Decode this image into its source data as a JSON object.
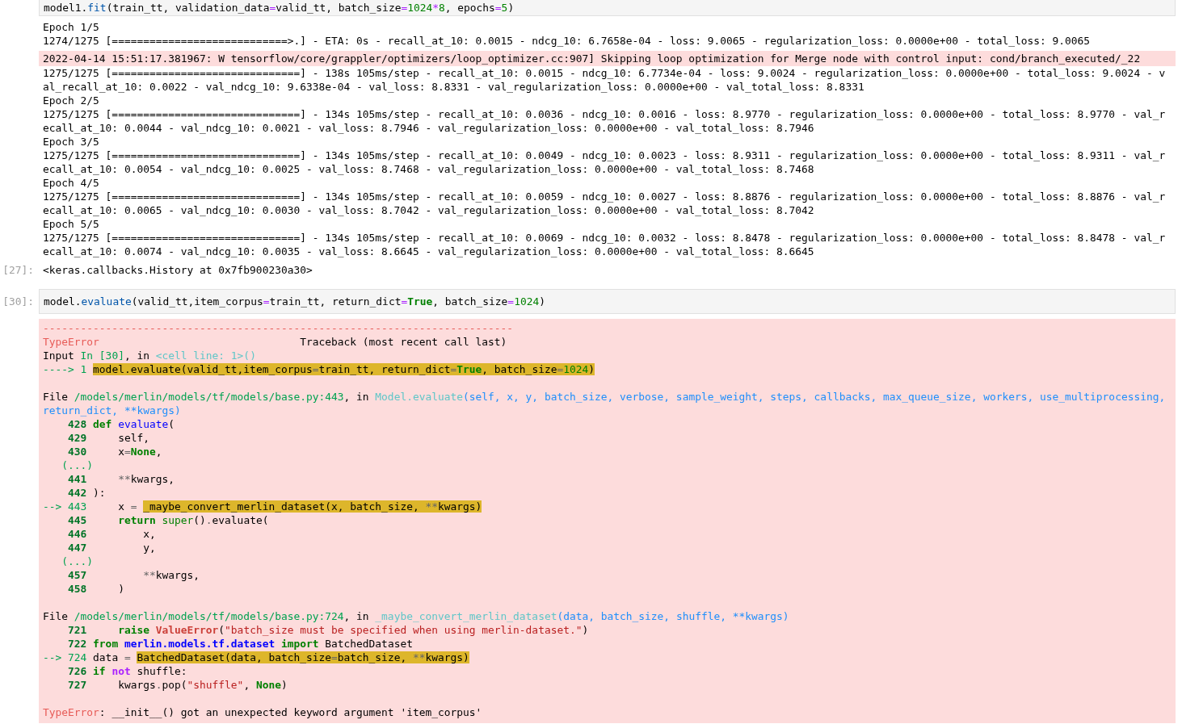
{
  "cells": [
    {
      "input": {
        "tokens": [
          {
            "kind": "plain",
            "text": "model1."
          },
          {
            "kind": "attr",
            "text": "fit"
          },
          {
            "kind": "plain",
            "text": "(train_tt, validation_data"
          },
          {
            "kind": "op",
            "text": "="
          },
          {
            "kind": "plain",
            "text": "valid_tt, batch_size"
          },
          {
            "kind": "op",
            "text": "="
          },
          {
            "kind": "num",
            "text": "1024"
          },
          {
            "kind": "op",
            "text": "*"
          },
          {
            "kind": "num",
            "text": "8"
          },
          {
            "kind": "plain",
            "text": ", epochs"
          },
          {
            "kind": "op",
            "text": "="
          },
          {
            "kind": "num",
            "text": "5"
          },
          {
            "kind": "plain",
            "text": ")"
          }
        ]
      },
      "outputs": [
        {
          "kind": "stdout",
          "lines": [
            "Epoch 1/5",
            "1274/1275 [============================>.] - ETA: 0s - recall_at_10: 0.0015 - ndcg_10: 6.7658e-04 - loss: 9.0065 - regularization_loss: 0.0000e+00 - total_loss: 9.0065"
          ]
        },
        {
          "kind": "stderr",
          "lines": [
            "2022-04-14 15:51:17.381967: W tensorflow/core/grappler/optimizers/loop_optimizer.cc:907] Skipping loop optimization for Merge node with control input: cond/branch_executed/_22"
          ]
        },
        {
          "kind": "stdout",
          "lines": [
            "1275/1275 [==============================] - 138s 105ms/step - recall_at_10: 0.0015 - ndcg_10: 6.7734e-04 - loss: 9.0024 - regularization_loss: 0.0000e+00 - total_loss: 9.0024 - v",
            "al_recall_at_10: 0.0022 - val_ndcg_10: 9.6338e-04 - val_loss: 8.8331 - val_regularization_loss: 0.0000e+00 - val_total_loss: 8.8331",
            "Epoch 2/5",
            "1275/1275 [==============================] - 134s 105ms/step - recall_at_10: 0.0036 - ndcg_10: 0.0016 - loss: 8.9770 - regularization_loss: 0.0000e+00 - total_loss: 8.9770 - val_r",
            "ecall_at_10: 0.0044 - val_ndcg_10: 0.0021 - val_loss: 8.7946 - val_regularization_loss: 0.0000e+00 - val_total_loss: 8.7946",
            "Epoch 3/5",
            "1275/1275 [==============================] - 134s 105ms/step - recall_at_10: 0.0049 - ndcg_10: 0.0023 - loss: 8.9311 - regularization_loss: 0.0000e+00 - total_loss: 8.9311 - val_r",
            "ecall_at_10: 0.0054 - val_ndcg_10: 0.0025 - val_loss: 8.7468 - val_regularization_loss: 0.0000e+00 - val_total_loss: 8.7468",
            "Epoch 4/5",
            "1275/1275 [==============================] - 134s 105ms/step - recall_at_10: 0.0059 - ndcg_10: 0.0027 - loss: 8.8876 - regularization_loss: 0.0000e+00 - total_loss: 8.8876 - val_r",
            "ecall_at_10: 0.0065 - val_ndcg_10: 0.0030 - val_loss: 8.7042 - val_regularization_loss: 0.0000e+00 - val_total_loss: 8.7042",
            "Epoch 5/5",
            "1275/1275 [==============================] - 134s 105ms/step - recall_at_10: 0.0069 - ndcg_10: 0.0032 - loss: 8.8478 - regularization_loss: 0.0000e+00 - total_loss: 8.8478 - val_r",
            "ecall_at_10: 0.0074 - val_ndcg_10: 0.0035 - val_loss: 8.6645 - val_regularization_loss: 0.0000e+00 - val_total_loss: 8.6645"
          ]
        },
        {
          "kind": "result",
          "prompt": "[27]:",
          "lines": [
            "<keras.callbacks.History at 0x7fb900230a30>"
          ]
        }
      ]
    },
    {
      "input": {
        "prompt": "[30]:",
        "tokens": [
          {
            "kind": "plain",
            "text": "model."
          },
          {
            "kind": "attr",
            "text": "evaluate"
          },
          {
            "kind": "plain",
            "text": "(valid_tt,item_corpus"
          },
          {
            "kind": "op",
            "text": "="
          },
          {
            "kind": "plain",
            "text": "train_tt, return_dict"
          },
          {
            "kind": "op",
            "text": "="
          },
          {
            "kind": "kw",
            "text": "True"
          },
          {
            "kind": "plain",
            "text": ", batch_size"
          },
          {
            "kind": "op",
            "text": "="
          },
          {
            "kind": "num",
            "text": "1024"
          },
          {
            "kind": "plain",
            "text": ")"
          }
        ]
      },
      "outputs": [
        {
          "kind": "error",
          "lines": [
            {
              "kind": "text",
              "segs": [
                {
                  "kind": "red",
                  "text": "---------------------------------------------------------------------------"
                }
              ]
            },
            {
              "kind": "text",
              "segs": [
                {
                  "kind": "red",
                  "text": "TypeError"
                },
                {
                  "kind": "plain",
                  "text": "                                Traceback (most recent call last)"
                }
              ]
            },
            {
              "kind": "text",
              "segs": [
                {
                  "kind": "plain",
                  "text": "Input "
                },
                {
                  "kind": "green",
                  "text": "In [30]"
                },
                {
                  "kind": "plain",
                  "text": ", in "
                },
                {
                  "kind": "cyan",
                  "text": "<cell line: 1>()"
                }
              ]
            },
            {
              "kind": "text",
              "segs": [
                {
                  "kind": "green",
                  "text": "----> 1 "
                },
                {
                  "kind": "highlight",
                  "parts": [
                    {
                      "kind": "plain",
                      "text": "model.evaluate(valid_tt,item_corpus"
                    },
                    {
                      "kind": "punct",
                      "text": "="
                    },
                    {
                      "kind": "plain",
                      "text": "train_tt, return_dict"
                    },
                    {
                      "kind": "punct",
                      "text": "="
                    },
                    {
                      "kind": "kw",
                      "text": "True"
                    },
                    {
                      "kind": "plain",
                      "text": ", batch_size"
                    },
                    {
                      "kind": "punct",
                      "text": "="
                    },
                    {
                      "kind": "num",
                      "text": "1024"
                    },
                    {
                      "kind": "plain",
                      "text": ")"
                    }
                  ]
                }
              ]
            },
            {
              "kind": "blank"
            },
            {
              "kind": "text",
              "segs": [
                {
                  "kind": "plain",
                  "text": "File "
                },
                {
                  "kind": "green",
                  "text": "/models/merlin/models/tf/models/base.py:443"
                },
                {
                  "kind": "plain",
                  "text": ", in "
                },
                {
                  "kind": "cyan",
                  "text": "Model.evaluate"
                },
                {
                  "kind": "blue",
                  "text": "(self, x, y, batch_size, verbose, sample_weight, steps, callbacks, max_queue_size, workers, use_multiprocessing,"
                }
              ]
            },
            {
              "kind": "text",
              "segs": [
                {
                  "kind": "blue",
                  "text": "return_dict, **kwargs)"
                }
              ]
            },
            {
              "kind": "text",
              "segs": [
                {
                  "kind": "ln",
                  "text": "    428 "
                },
                {
                  "kind": "kw",
                  "text": "def "
                },
                {
                  "kind": "fn",
                  "text": "evaluate"
                },
                {
                  "kind": "plain",
                  "text": "("
                }
              ]
            },
            {
              "kind": "text",
              "segs": [
                {
                  "kind": "ln",
                  "text": "    429 "
                },
                {
                  "kind": "plain",
                  "text": "    self,"
                }
              ]
            },
            {
              "kind": "text",
              "segs": [
                {
                  "kind": "ln",
                  "text": "    430 "
                },
                {
                  "kind": "plain",
                  "text": "    x"
                },
                {
                  "kind": "punct",
                  "text": "="
                },
                {
                  "kind": "kw",
                  "text": "None"
                },
                {
                  "kind": "plain",
                  "text": ","
                }
              ]
            },
            {
              "kind": "text",
              "segs": [
                {
                  "kind": "green",
                  "text": "   (...)"
                }
              ]
            },
            {
              "kind": "text",
              "segs": [
                {
                  "kind": "ln",
                  "text": "    441     "
                },
                {
                  "kind": "punct",
                  "text": "**"
                },
                {
                  "kind": "plain",
                  "text": "kwargs,"
                }
              ]
            },
            {
              "kind": "text",
              "segs": [
                {
                  "kind": "ln",
                  "text": "    442 "
                },
                {
                  "kind": "plain",
                  "text": "):"
                }
              ]
            },
            {
              "kind": "text",
              "segs": [
                {
                  "kind": "green",
                  "text": "--> 443 "
                },
                {
                  "kind": "plain",
                  "text": "    x "
                },
                {
                  "kind": "punct",
                  "text": "= "
                },
                {
                  "kind": "highlight",
                  "parts": [
                    {
                      "kind": "plain",
                      "text": "_maybe_convert_merlin_dataset(x, batch_size, "
                    },
                    {
                      "kind": "punct",
                      "text": "**"
                    },
                    {
                      "kind": "plain",
                      "text": "kwargs)"
                    }
                  ]
                }
              ]
            },
            {
              "kind": "text",
              "segs": [
                {
                  "kind": "ln",
                  "text": "    445     "
                },
                {
                  "kind": "kw",
                  "text": "return "
                },
                {
                  "kind": "builtin",
                  "text": "super"
                },
                {
                  "kind": "plain",
                  "text": "()"
                },
                {
                  "kind": "punct",
                  "text": "."
                },
                {
                  "kind": "plain",
                  "text": "evaluate("
                }
              ]
            },
            {
              "kind": "text",
              "segs": [
                {
                  "kind": "ln",
                  "text": "    446 "
                },
                {
                  "kind": "plain",
                  "text": "        x,"
                }
              ]
            },
            {
              "kind": "text",
              "segs": [
                {
                  "kind": "ln",
                  "text": "    447 "
                },
                {
                  "kind": "plain",
                  "text": "        y,"
                }
              ]
            },
            {
              "kind": "text",
              "segs": [
                {
                  "kind": "green",
                  "text": "   (...)"
                }
              ]
            },
            {
              "kind": "text",
              "segs": [
                {
                  "kind": "ln",
                  "text": "    457         "
                },
                {
                  "kind": "punct",
                  "text": "**"
                },
                {
                  "kind": "plain",
                  "text": "kwargs,"
                }
              ]
            },
            {
              "kind": "text",
              "segs": [
                {
                  "kind": "ln",
                  "text": "    458 "
                },
                {
                  "kind": "plain",
                  "text": "    )"
                }
              ]
            },
            {
              "kind": "blank"
            },
            {
              "kind": "text",
              "segs": [
                {
                  "kind": "plain",
                  "text": "File "
                },
                {
                  "kind": "green",
                  "text": "/models/merlin/models/tf/models/base.py:724"
                },
                {
                  "kind": "plain",
                  "text": ", in "
                },
                {
                  "kind": "cyan",
                  "text": "_maybe_convert_merlin_dataset"
                },
                {
                  "kind": "blue",
                  "text": "(data, batch_size, shuffle, **kwargs)"
                }
              ]
            },
            {
              "kind": "text",
              "segs": [
                {
                  "kind": "ln",
                  "text": "    721     "
                },
                {
                  "kind": "kw",
                  "text": "raise "
                },
                {
                  "kind": "exc",
                  "text": "ValueError"
                },
                {
                  "kind": "plain",
                  "text": "("
                },
                {
                  "kind": "str",
                  "text": "\"batch_size must be specified when using merlin-dataset.\""
                },
                {
                  "kind": "plain",
                  "text": ")"
                }
              ]
            },
            {
              "kind": "text",
              "segs": [
                {
                  "kind": "ln",
                  "text": "    722 "
                },
                {
                  "kind": "kw",
                  "text": "from "
                },
                {
                  "kind": "module",
                  "text": "merlin.models.tf.dataset "
                },
                {
                  "kind": "kw",
                  "text": "import"
                },
                {
                  "kind": "plain",
                  "text": " BatchedDataset"
                }
              ]
            },
            {
              "kind": "text",
              "segs": [
                {
                  "kind": "green",
                  "text": "--> 724 "
                },
                {
                  "kind": "plain",
                  "text": "data "
                },
                {
                  "kind": "punct",
                  "text": "= "
                },
                {
                  "kind": "highlight",
                  "parts": [
                    {
                      "kind": "plain",
                      "text": "BatchedDataset(data, batch_size"
                    },
                    {
                      "kind": "punct",
                      "text": "="
                    },
                    {
                      "kind": "plain",
                      "text": "batch_size, "
                    },
                    {
                      "kind": "punct",
                      "text": "**"
                    },
                    {
                      "kind": "plain",
                      "text": "kwargs)"
                    }
                  ]
                }
              ]
            },
            {
              "kind": "text",
              "segs": [
                {
                  "kind": "ln",
                  "text": "    726 "
                },
                {
                  "kind": "kw",
                  "text": "if "
                },
                {
                  "kind": "kwop",
                  "text": "not"
                },
                {
                  "kind": "plain",
                  "text": " shuffle:"
                }
              ]
            },
            {
              "kind": "text",
              "segs": [
                {
                  "kind": "ln",
                  "text": "    727 "
                },
                {
                  "kind": "plain",
                  "text": "    kwargs"
                },
                {
                  "kind": "punct",
                  "text": "."
                },
                {
                  "kind": "plain",
                  "text": "pop("
                },
                {
                  "kind": "str",
                  "text": "\"shuffle\""
                },
                {
                  "kind": "plain",
                  "text": ", "
                },
                {
                  "kind": "kw",
                  "text": "None"
                },
                {
                  "kind": "plain",
                  "text": ")"
                }
              ]
            },
            {
              "kind": "blank"
            },
            {
              "kind": "text",
              "segs": [
                {
                  "kind": "red",
                  "text": "TypeError"
                },
                {
                  "kind": "plain",
                  "text": ": __init__() got an unexpected keyword argument 'item_corpus'"
                }
              ]
            }
          ]
        }
      ]
    }
  ]
}
